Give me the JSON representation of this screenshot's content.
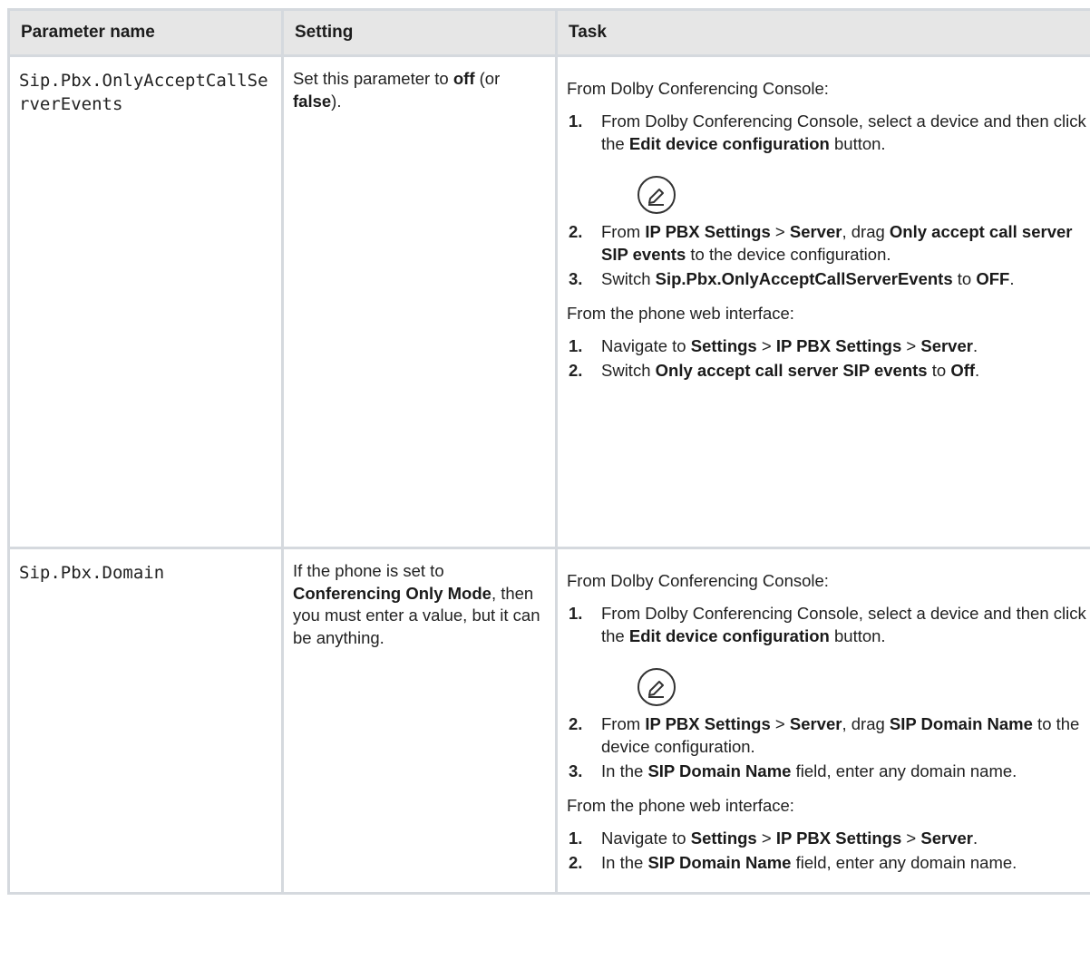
{
  "table": {
    "headers": [
      "Parameter name",
      "Setting",
      "Task"
    ],
    "rows": [
      {
        "param": "Sip.Pbx.OnlyAcceptCallServerEvents",
        "setting_parts": [
          {
            "t": "Set this parameter to ",
            "b": false
          },
          {
            "t": "off",
            "b": true
          },
          {
            "t": " (or ",
            "b": false
          },
          {
            "t": "false",
            "b": true
          },
          {
            "t": ").",
            "b": false
          }
        ],
        "task": {
          "console_lead": "From Dolby Conferencing Console:",
          "console_steps": [
            [
              {
                "t": "From Dolby Conferencing Console, select a device and then click the ",
                "b": false
              },
              {
                "t": "Edit device configuration",
                "b": true
              },
              {
                "t": " button.",
                "b": false
              }
            ],
            [
              {
                "t": "From ",
                "b": false
              },
              {
                "t": "IP PBX Settings",
                "b": true
              },
              {
                "t": " > ",
                "b": false
              },
              {
                "t": "Server",
                "b": true
              },
              {
                "t": ", drag ",
                "b": false
              },
              {
                "t": "Only accept call server SIP events",
                "b": true
              },
              {
                "t": " to the device configuration.",
                "b": false
              }
            ],
            [
              {
                "t": "Switch ",
                "b": false
              },
              {
                "t": "Sip.Pbx.OnlyAcceptCallServerEvents",
                "b": true
              },
              {
                "t": " to ",
                "b": false
              },
              {
                "t": "OFF",
                "b": true
              },
              {
                "t": ".",
                "b": false
              }
            ]
          ],
          "web_lead": "From the phone web interface:",
          "web_steps": [
            [
              {
                "t": "Navigate to ",
                "b": false
              },
              {
                "t": "Settings",
                "b": true
              },
              {
                "t": " > ",
                "b": false
              },
              {
                "t": "IP PBX Settings",
                "b": true
              },
              {
                "t": " > ",
                "b": false
              },
              {
                "t": "Server",
                "b": true
              },
              {
                "t": ".",
                "b": false
              }
            ],
            [
              {
                "t": "Switch ",
                "b": false
              },
              {
                "t": "Only accept call server SIP events",
                "b": true
              },
              {
                "t": " to ",
                "b": false
              },
              {
                "t": "Off",
                "b": true
              },
              {
                "t": ".",
                "b": false
              }
            ]
          ]
        }
      },
      {
        "param": "Sip.Pbx.Domain",
        "setting_parts": [
          {
            "t": "If the phone is set to ",
            "b": false
          },
          {
            "t": "Conferencing Only Mode",
            "b": true
          },
          {
            "t": ", then you must enter a value, but it can be anything.",
            "b": false
          }
        ],
        "task": {
          "console_lead": "From Dolby Conferencing Console:",
          "console_steps": [
            [
              {
                "t": "From Dolby Conferencing Console, select a device and then click the ",
                "b": false
              },
              {
                "t": "Edit device configuration",
                "b": true
              },
              {
                "t": " button.",
                "b": false
              }
            ],
            [
              {
                "t": "From ",
                "b": false
              },
              {
                "t": "IP PBX Settings",
                "b": true
              },
              {
                "t": " > ",
                "b": false
              },
              {
                "t": "Server",
                "b": true
              },
              {
                "t": ", drag ",
                "b": false
              },
              {
                "t": "SIP Domain Name",
                "b": true
              },
              {
                "t": " to the device configuration.",
                "b": false
              }
            ],
            [
              {
                "t": "In the ",
                "b": false
              },
              {
                "t": "SIP Domain Name",
                "b": true
              },
              {
                "t": " field, enter any domain name.",
                "b": false
              }
            ]
          ],
          "web_lead": "From the phone web interface:",
          "web_steps": [
            [
              {
                "t": "Navigate to ",
                "b": false
              },
              {
                "t": "Settings",
                "b": true
              },
              {
                "t": " > ",
                "b": false
              },
              {
                "t": "IP PBX Settings",
                "b": true
              },
              {
                "t": " > ",
                "b": false
              },
              {
                "t": "Server",
                "b": true
              },
              {
                "t": ".",
                "b": false
              }
            ],
            [
              {
                "t": "In the ",
                "b": false
              },
              {
                "t": "SIP Domain Name",
                "b": true
              },
              {
                "t": " field, enter any domain name.",
                "b": false
              }
            ]
          ]
        }
      }
    ]
  },
  "icons": {
    "edit_button_icon": "edit-pencil-circle-icon"
  },
  "colors": {
    "header_bg": "#e6e6e6",
    "border": "#d5d9de",
    "text": "#222222"
  }
}
